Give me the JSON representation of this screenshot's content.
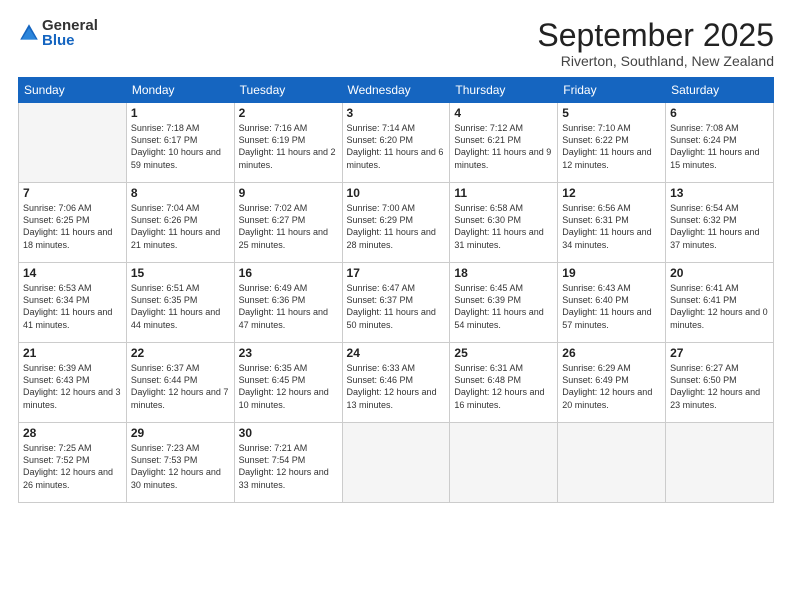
{
  "header": {
    "logo_general": "General",
    "logo_blue": "Blue",
    "month_title": "September 2025",
    "location": "Riverton, Southland, New Zealand"
  },
  "weekdays": [
    "Sunday",
    "Monday",
    "Tuesday",
    "Wednesday",
    "Thursday",
    "Friday",
    "Saturday"
  ],
  "weeks": [
    [
      {
        "day": "",
        "empty": true
      },
      {
        "day": "1",
        "sunrise": "Sunrise: 7:18 AM",
        "sunset": "Sunset: 6:17 PM",
        "daylight": "Daylight: 10 hours and 59 minutes."
      },
      {
        "day": "2",
        "sunrise": "Sunrise: 7:16 AM",
        "sunset": "Sunset: 6:19 PM",
        "daylight": "Daylight: 11 hours and 2 minutes."
      },
      {
        "day": "3",
        "sunrise": "Sunrise: 7:14 AM",
        "sunset": "Sunset: 6:20 PM",
        "daylight": "Daylight: 11 hours and 6 minutes."
      },
      {
        "day": "4",
        "sunrise": "Sunrise: 7:12 AM",
        "sunset": "Sunset: 6:21 PM",
        "daylight": "Daylight: 11 hours and 9 minutes."
      },
      {
        "day": "5",
        "sunrise": "Sunrise: 7:10 AM",
        "sunset": "Sunset: 6:22 PM",
        "daylight": "Daylight: 11 hours and 12 minutes."
      },
      {
        "day": "6",
        "sunrise": "Sunrise: 7:08 AM",
        "sunset": "Sunset: 6:24 PM",
        "daylight": "Daylight: 11 hours and 15 minutes."
      }
    ],
    [
      {
        "day": "7",
        "sunrise": "Sunrise: 7:06 AM",
        "sunset": "Sunset: 6:25 PM",
        "daylight": "Daylight: 11 hours and 18 minutes."
      },
      {
        "day": "8",
        "sunrise": "Sunrise: 7:04 AM",
        "sunset": "Sunset: 6:26 PM",
        "daylight": "Daylight: 11 hours and 21 minutes."
      },
      {
        "day": "9",
        "sunrise": "Sunrise: 7:02 AM",
        "sunset": "Sunset: 6:27 PM",
        "daylight": "Daylight: 11 hours and 25 minutes."
      },
      {
        "day": "10",
        "sunrise": "Sunrise: 7:00 AM",
        "sunset": "Sunset: 6:29 PM",
        "daylight": "Daylight: 11 hours and 28 minutes."
      },
      {
        "day": "11",
        "sunrise": "Sunrise: 6:58 AM",
        "sunset": "Sunset: 6:30 PM",
        "daylight": "Daylight: 11 hours and 31 minutes."
      },
      {
        "day": "12",
        "sunrise": "Sunrise: 6:56 AM",
        "sunset": "Sunset: 6:31 PM",
        "daylight": "Daylight: 11 hours and 34 minutes."
      },
      {
        "day": "13",
        "sunrise": "Sunrise: 6:54 AM",
        "sunset": "Sunset: 6:32 PM",
        "daylight": "Daylight: 11 hours and 37 minutes."
      }
    ],
    [
      {
        "day": "14",
        "sunrise": "Sunrise: 6:53 AM",
        "sunset": "Sunset: 6:34 PM",
        "daylight": "Daylight: 11 hours and 41 minutes."
      },
      {
        "day": "15",
        "sunrise": "Sunrise: 6:51 AM",
        "sunset": "Sunset: 6:35 PM",
        "daylight": "Daylight: 11 hours and 44 minutes."
      },
      {
        "day": "16",
        "sunrise": "Sunrise: 6:49 AM",
        "sunset": "Sunset: 6:36 PM",
        "daylight": "Daylight: 11 hours and 47 minutes."
      },
      {
        "day": "17",
        "sunrise": "Sunrise: 6:47 AM",
        "sunset": "Sunset: 6:37 PM",
        "daylight": "Daylight: 11 hours and 50 minutes."
      },
      {
        "day": "18",
        "sunrise": "Sunrise: 6:45 AM",
        "sunset": "Sunset: 6:39 PM",
        "daylight": "Daylight: 11 hours and 54 minutes."
      },
      {
        "day": "19",
        "sunrise": "Sunrise: 6:43 AM",
        "sunset": "Sunset: 6:40 PM",
        "daylight": "Daylight: 11 hours and 57 minutes."
      },
      {
        "day": "20",
        "sunrise": "Sunrise: 6:41 AM",
        "sunset": "Sunset: 6:41 PM",
        "daylight": "Daylight: 12 hours and 0 minutes."
      }
    ],
    [
      {
        "day": "21",
        "sunrise": "Sunrise: 6:39 AM",
        "sunset": "Sunset: 6:43 PM",
        "daylight": "Daylight: 12 hours and 3 minutes."
      },
      {
        "day": "22",
        "sunrise": "Sunrise: 6:37 AM",
        "sunset": "Sunset: 6:44 PM",
        "daylight": "Daylight: 12 hours and 7 minutes."
      },
      {
        "day": "23",
        "sunrise": "Sunrise: 6:35 AM",
        "sunset": "Sunset: 6:45 PM",
        "daylight": "Daylight: 12 hours and 10 minutes."
      },
      {
        "day": "24",
        "sunrise": "Sunrise: 6:33 AM",
        "sunset": "Sunset: 6:46 PM",
        "daylight": "Daylight: 12 hours and 13 minutes."
      },
      {
        "day": "25",
        "sunrise": "Sunrise: 6:31 AM",
        "sunset": "Sunset: 6:48 PM",
        "daylight": "Daylight: 12 hours and 16 minutes."
      },
      {
        "day": "26",
        "sunrise": "Sunrise: 6:29 AM",
        "sunset": "Sunset: 6:49 PM",
        "daylight": "Daylight: 12 hours and 20 minutes."
      },
      {
        "day": "27",
        "sunrise": "Sunrise: 6:27 AM",
        "sunset": "Sunset: 6:50 PM",
        "daylight": "Daylight: 12 hours and 23 minutes."
      }
    ],
    [
      {
        "day": "28",
        "sunrise": "Sunrise: 7:25 AM",
        "sunset": "Sunset: 7:52 PM",
        "daylight": "Daylight: 12 hours and 26 minutes."
      },
      {
        "day": "29",
        "sunrise": "Sunrise: 7:23 AM",
        "sunset": "Sunset: 7:53 PM",
        "daylight": "Daylight: 12 hours and 30 minutes."
      },
      {
        "day": "30",
        "sunrise": "Sunrise: 7:21 AM",
        "sunset": "Sunset: 7:54 PM",
        "daylight": "Daylight: 12 hours and 33 minutes."
      },
      {
        "day": "",
        "empty": true
      },
      {
        "day": "",
        "empty": true
      },
      {
        "day": "",
        "empty": true
      },
      {
        "day": "",
        "empty": true
      }
    ]
  ]
}
